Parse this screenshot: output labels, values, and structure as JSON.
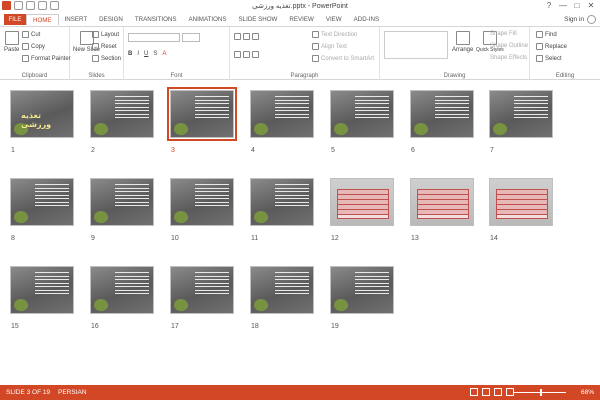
{
  "window": {
    "title": "تغذیه ورزشی.pptx - PowerPoint",
    "minimize": "—",
    "maximize": "□",
    "close": "✕"
  },
  "tabs": [
    {
      "label": "FILE"
    },
    {
      "label": "HOME"
    },
    {
      "label": "INSERT"
    },
    {
      "label": "DESIGN"
    },
    {
      "label": "TRANSITIONS"
    },
    {
      "label": "ANIMATIONS"
    },
    {
      "label": "SLIDE SHOW"
    },
    {
      "label": "REVIEW"
    },
    {
      "label": "VIEW"
    },
    {
      "label": "ADD-INS"
    }
  ],
  "signin": "Sign in",
  "ribbon": {
    "clipboard": {
      "label": "Clipboard",
      "paste": "Paste",
      "cut": "Cut",
      "copy": "Copy",
      "format_painter": "Format Painter"
    },
    "slides": {
      "label": "Slides",
      "new_slide": "New Slide",
      "layout": "Layout",
      "reset": "Reset",
      "section": "Section"
    },
    "font": {
      "label": "Font"
    },
    "paragraph": {
      "label": "Paragraph",
      "text_direction": "Text Direction",
      "align_text": "Align Text",
      "convert_smartart": "Convert to SmartArt"
    },
    "drawing": {
      "label": "Drawing",
      "arrange": "Arrange",
      "quick_styles": "Quick Styles",
      "shape_fill": "Shape Fill",
      "shape_outline": "Shape Outline",
      "shape_effects": "Shape Effects"
    },
    "editing": {
      "label": "Editing",
      "find": "Find",
      "replace": "Replace",
      "select": "Select"
    }
  },
  "slides": [
    {
      "number": "1",
      "title_text": "تغذیه ورزشی"
    },
    {
      "number": "2"
    },
    {
      "number": "3"
    },
    {
      "number": "4"
    },
    {
      "number": "5"
    },
    {
      "number": "6"
    },
    {
      "number": "7"
    },
    {
      "number": "8"
    },
    {
      "number": "9"
    },
    {
      "number": "10"
    },
    {
      "number": "11"
    },
    {
      "number": "12"
    },
    {
      "number": "13"
    },
    {
      "number": "14"
    },
    {
      "number": "15"
    },
    {
      "number": "16"
    },
    {
      "number": "17"
    },
    {
      "number": "18"
    },
    {
      "number": "19"
    }
  ],
  "selected_slide": "3",
  "status": {
    "slide_info": "SLIDE 3 OF 19",
    "language": "PERSIAN",
    "zoom": "68%"
  },
  "colors": {
    "accent": "#d24726"
  }
}
